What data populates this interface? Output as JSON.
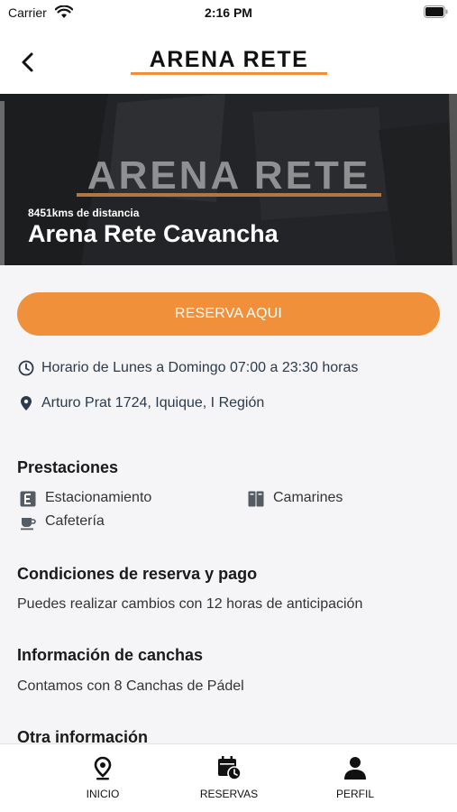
{
  "status_bar": {
    "carrier": "Carrier",
    "time": "2:16 PM"
  },
  "header": {
    "logo_text": "ARENA RETE",
    "brand_color": "#f0903a"
  },
  "hero": {
    "logo_text": "ARENA RETE",
    "distance": "8451kms de distancia",
    "title": "Arena Rete Cavancha"
  },
  "reserve_button": {
    "label": "RESERVA AQUI",
    "color": "#f0903a"
  },
  "info": {
    "schedule": "Horario de Lunes a Domingo 07:00 a 23:30 horas",
    "address": "Arturo Prat 1724, Iquique, I Región"
  },
  "prestaciones": {
    "title": "Prestaciones",
    "items": [
      {
        "label": "Estacionamiento",
        "icon": "parking-icon"
      },
      {
        "label": "Camarines",
        "icon": "locker-icon"
      },
      {
        "label": "Cafetería",
        "icon": "coffee-icon"
      }
    ]
  },
  "condiciones": {
    "title": "Condiciones de reserva y pago",
    "text": "Puedes realizar cambios con 12 horas de anticipación"
  },
  "canchas": {
    "title": "Información de canchas",
    "text": "Contamos con 8 Canchas de Pádel"
  },
  "otra": {
    "title": "Otra información"
  },
  "tabs": [
    {
      "label": "INICIO",
      "icon": "location-pin-icon"
    },
    {
      "label": "RESERVAS",
      "icon": "calendar-clock-icon"
    },
    {
      "label": "PERFIL",
      "icon": "person-icon"
    }
  ]
}
